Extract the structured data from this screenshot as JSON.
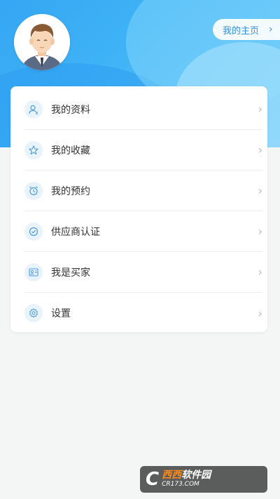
{
  "header": {
    "home_label": "我的主页",
    "home_chevron": "›"
  },
  "menu": {
    "items": [
      {
        "label": "我的资料",
        "icon": "profile-icon"
      },
      {
        "label": "我的收藏",
        "icon": "star-icon"
      },
      {
        "label": "我的预约",
        "icon": "alarm-clock-icon"
      },
      {
        "label": "供应商认证",
        "icon": "verified-badge-icon"
      },
      {
        "label": "我是买家",
        "icon": "buyer-card-icon"
      },
      {
        "label": "设置",
        "icon": "gear-icon"
      }
    ],
    "arrow": "›"
  },
  "watermark": {
    "brand_left": "西西",
    "brand_right": "软件园",
    "url": "CR173.COM"
  },
  "colors": {
    "accent": "#35a6f3",
    "icon_color": "#4a9be0",
    "icon_bg": "#e9f3fb"
  }
}
